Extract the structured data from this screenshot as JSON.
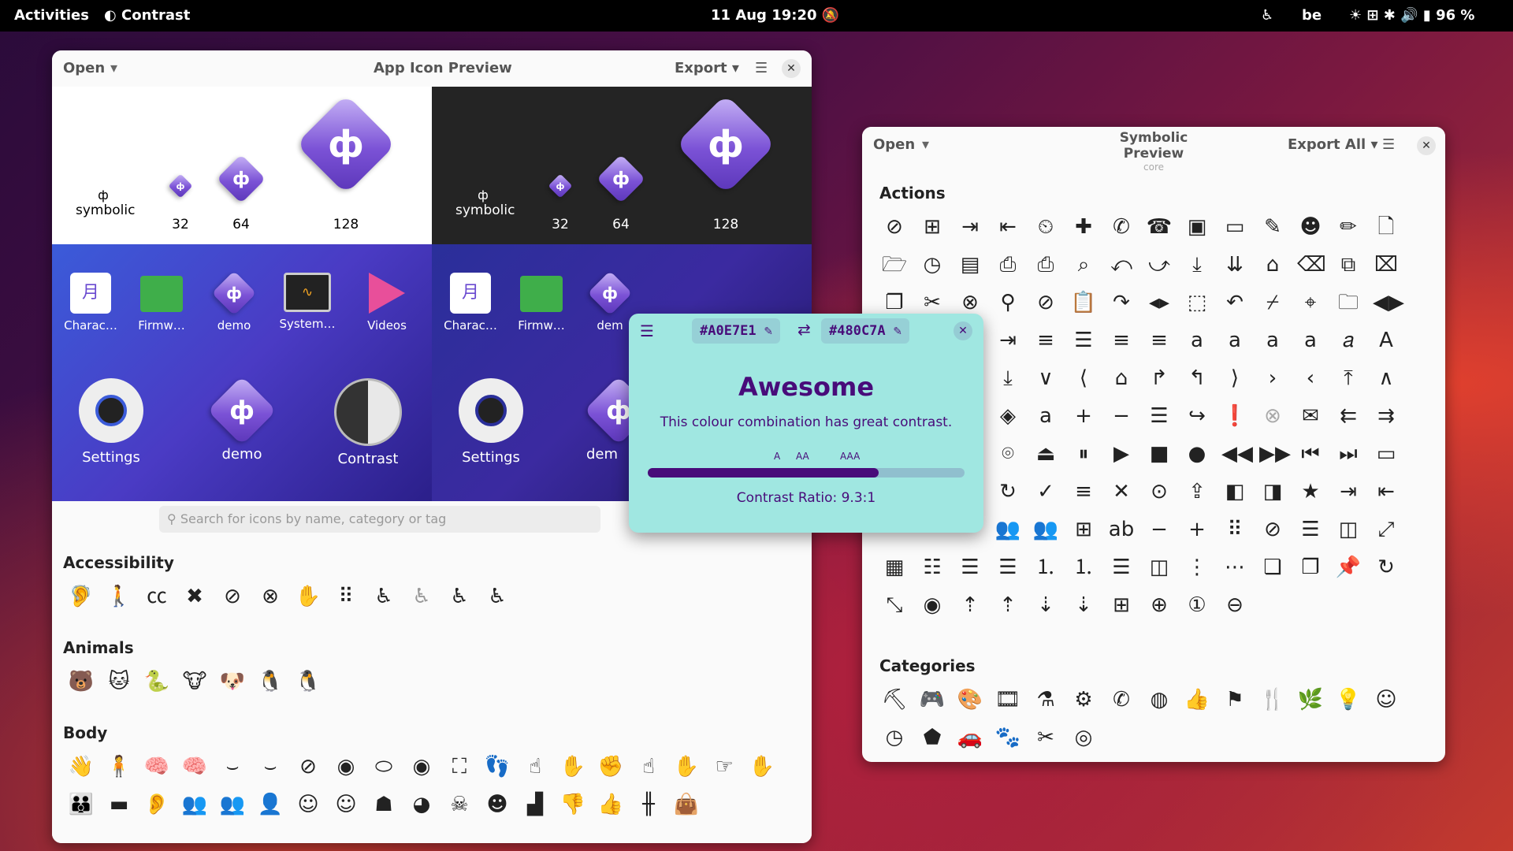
{
  "topbar": {
    "activities": "Activities",
    "app": "Contrast",
    "date": "11 Aug",
    "time": "19:20",
    "keyboard": "be",
    "battery": "96 %"
  },
  "app_icon_preview": {
    "open": "Open",
    "title": "App Icon Preview",
    "export": "Export",
    "sizes": [
      "symbolic",
      "32",
      "64",
      "128"
    ],
    "apps_row": [
      "Charac…",
      "Firmw…",
      "demo",
      "System…",
      "Videos"
    ],
    "apps_row_dark": [
      "Charac…",
      "Firmw…",
      "dem"
    ],
    "big_row": [
      "Settings",
      "demo",
      "Contrast"
    ],
    "big_row_dark": [
      "Settings",
      "dem"
    ],
    "search_placeholder": "Search for icons by name, category or tag",
    "sections": [
      "Accessibility",
      "Animals",
      "Body"
    ]
  },
  "contrast_popup": {
    "fg": "#A0E7E1",
    "bg": "#480C7A",
    "headline": "Awesome",
    "message": "This colour combination has great contrast.",
    "levels": [
      "A",
      "AA",
      "AAA"
    ],
    "ratio_text": "Contrast Ratio: 9.3:1",
    "ratio_fill": 0.73
  },
  "symbolic_preview": {
    "open": "Open",
    "title": "Symbolic Preview",
    "subtitle": "core",
    "export": "Export All",
    "sections": [
      "Actions",
      "Categories"
    ]
  },
  "icons": {
    "search": "search-icon",
    "menu": "hamburger-menu-icon",
    "close": "close-icon",
    "swap": "swap-icon",
    "pick": "eyedropper-icon"
  }
}
